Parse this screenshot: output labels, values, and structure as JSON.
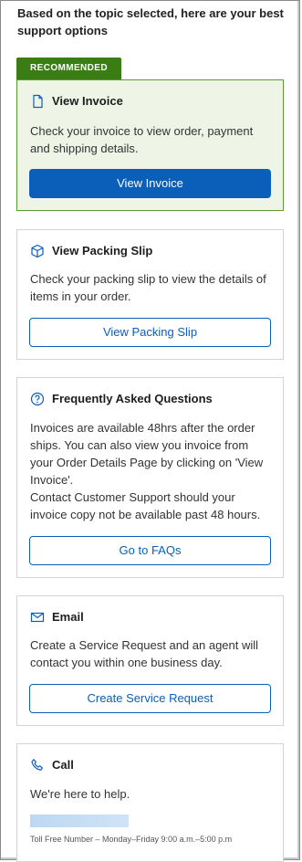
{
  "intro": {
    "text": "Based on the topic selected, here are your best support options"
  },
  "recommended_badge": "RECOMMENDED",
  "cards": [
    {
      "id": "view-invoice",
      "icon": "document-icon",
      "title": "View Invoice",
      "body": "Check your invoice to view order, payment and shipping details.",
      "button": "View Invoice",
      "button_style": "primary"
    },
    {
      "id": "packing-slip",
      "icon": "box-icon",
      "title": "View Packing Slip",
      "body": "Check your packing slip to view the details of items in your order.",
      "button": "View Packing Slip",
      "button_style": "outline"
    },
    {
      "id": "faq",
      "icon": "help-circle-icon",
      "title": "Frequently Asked Questions",
      "body": "Invoices are available 48hrs after the order ships. You can also view you invoice from your Order Details Page by clicking on 'View Invoice'.",
      "body2": "Contact Customer Support should your invoice copy not be available past 48 hours.",
      "button": "Go to FAQs",
      "button_style": "outline"
    },
    {
      "id": "email",
      "icon": "mail-icon",
      "title": "Email",
      "body": "Create a Service Request and an agent will contact you within one business day.",
      "button": "Create Service Request",
      "button_style": "outline"
    },
    {
      "id": "call",
      "icon": "phone-icon",
      "title": "Call",
      "body": "We're here to help.",
      "footnote": "Toll Free Number – Monday–Friday 9:00 a.m.–5:00 p.m"
    }
  ],
  "colors": {
    "accent": "#0b5fb8",
    "recommended_green": "#3a7d14",
    "recommended_bg": "#eef5e7"
  }
}
